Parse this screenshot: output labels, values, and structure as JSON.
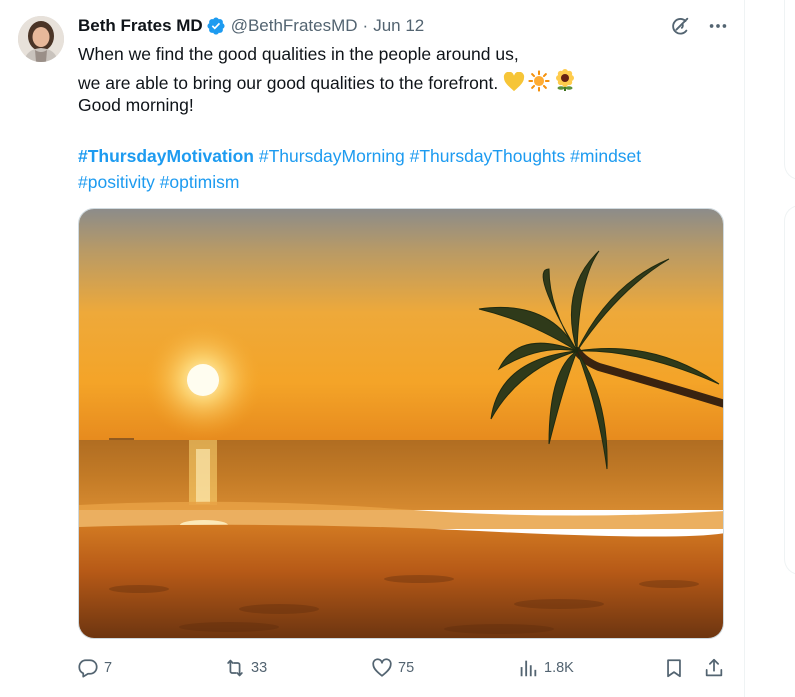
{
  "tweet": {
    "author_name": "Beth Frates MD",
    "handle": "@BethFratesMD",
    "separator": "·",
    "date": "Jun 12",
    "text_lines": [
      "When we find the good qualities in the people around us,",
      "we are able to bring our good qualities to the forefront.",
      "Good morning!"
    ],
    "emojis": [
      "yellow-heart",
      "sun",
      "sunflower"
    ],
    "hashtags_line1": {
      "bold": "#ThursdayMotivation",
      "rest": " #ThursdayMorning #ThursdayThoughts #mindset"
    },
    "hashtags_line2": "#positivity #optimism",
    "media_icon": "beach-sunset-palm-image"
  },
  "actions": {
    "reply_count": "7",
    "retweet_count": "33",
    "like_count": "75",
    "views_count": "1.8K"
  },
  "colors": {
    "link": "#1d9bf0",
    "verified": "#1d9bf0",
    "muted": "#536471"
  }
}
